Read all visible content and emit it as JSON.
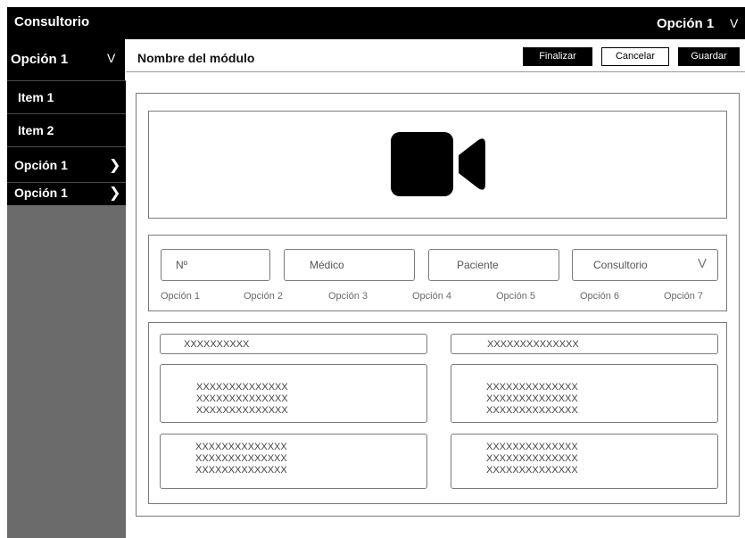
{
  "topbar": {
    "app_title": "Consultorio",
    "option_label": "Opción 1",
    "chevron": "V"
  },
  "sidebar": {
    "header": {
      "label": "Opción 1",
      "chevron": "V"
    },
    "items": [
      {
        "label": "Item 1"
      },
      {
        "label": "Item 2"
      }
    ],
    "options": [
      {
        "label": "Opción 1",
        "chevron": "❯"
      },
      {
        "label": "Opción 1",
        "chevron": "❯"
      }
    ]
  },
  "header": {
    "title": "Nombre del módulo",
    "buttons": {
      "finalizar": "Finalizar",
      "cancelar": "Cancelar",
      "guardar": "Guardar"
    }
  },
  "video": {
    "icon": "video-camera-icon"
  },
  "filters": {
    "fields": [
      {
        "label": "Nº"
      },
      {
        "label": "Médico"
      },
      {
        "label": "Paciente"
      },
      {
        "label": "Consultorio",
        "chevron": "V"
      }
    ],
    "options": [
      "Opción 1",
      "Opción 2",
      "Opción 3",
      "Opción 4",
      "Opción 5",
      "Opción 6",
      "Opción 7"
    ]
  },
  "details": {
    "left": {
      "field": "XXXXXXXXXX",
      "area1": [
        "XXXXXXXXXXXXXX",
        "XXXXXXXXXXXXXX",
        "XXXXXXXXXXXXXX"
      ],
      "area2": [
        "XXXXXXXXXXXXXX",
        "XXXXXXXXXXXXXX",
        "XXXXXXXXXXXXXX"
      ]
    },
    "right": {
      "field": "XXXXXXXXXXXXXX",
      "area1": [
        "XXXXXXXXXXXXXX",
        "XXXXXXXXXXXXXX",
        "XXXXXXXXXXXXXX"
      ],
      "area2": [
        "XXXXXXXXXXXXXX",
        "XXXXXXXXXXXXXX",
        "XXXXXXXXXXXXXX"
      ]
    }
  }
}
